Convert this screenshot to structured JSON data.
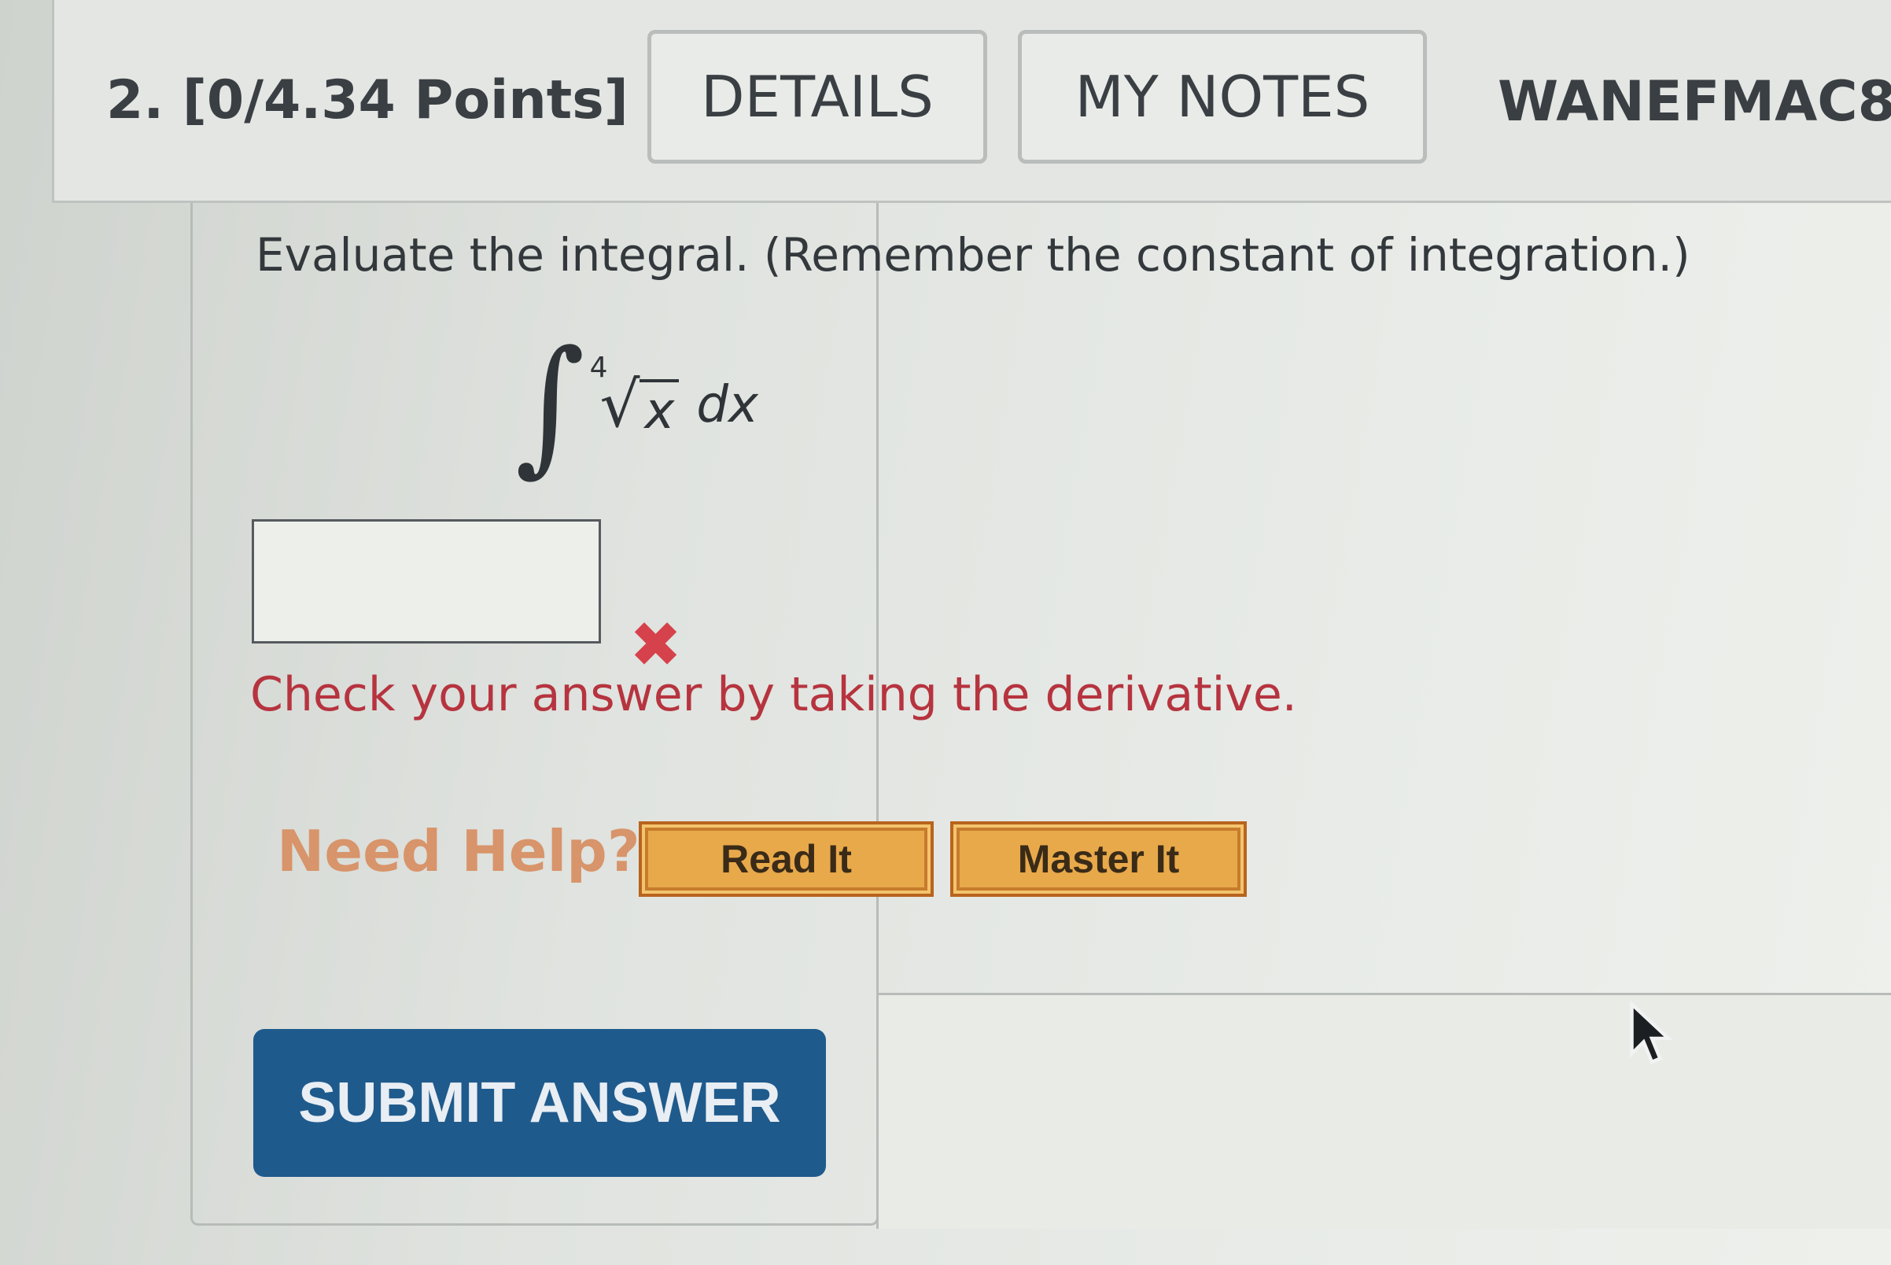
{
  "question": {
    "number_points": "2.  [0/4.34 Points]",
    "course_code": "WANEFMAC8"
  },
  "header_buttons": {
    "details": "DETAILS",
    "my_notes": "MY NOTES"
  },
  "prompt": "Evaluate the integral. (Remember the constant of integration.)",
  "integral": {
    "sign": "∫",
    "root_index": "4",
    "radical": "√",
    "radicand": "x",
    "differential": "dx"
  },
  "answer": {
    "value": "",
    "status_icon": "x-mark-icon",
    "status_symbol": "✖",
    "feedback": "Check your answer by taking the derivative."
  },
  "help": {
    "label": "Need Help?",
    "read_it": "Read It",
    "master_it": "Master It"
  },
  "submit_label": "SUBMIT ANSWER",
  "colors": {
    "submit_bg": "#1f5a8c",
    "feedback": "#b6343f",
    "help_label": "#d8946a",
    "help_button": "#e8a94a"
  }
}
